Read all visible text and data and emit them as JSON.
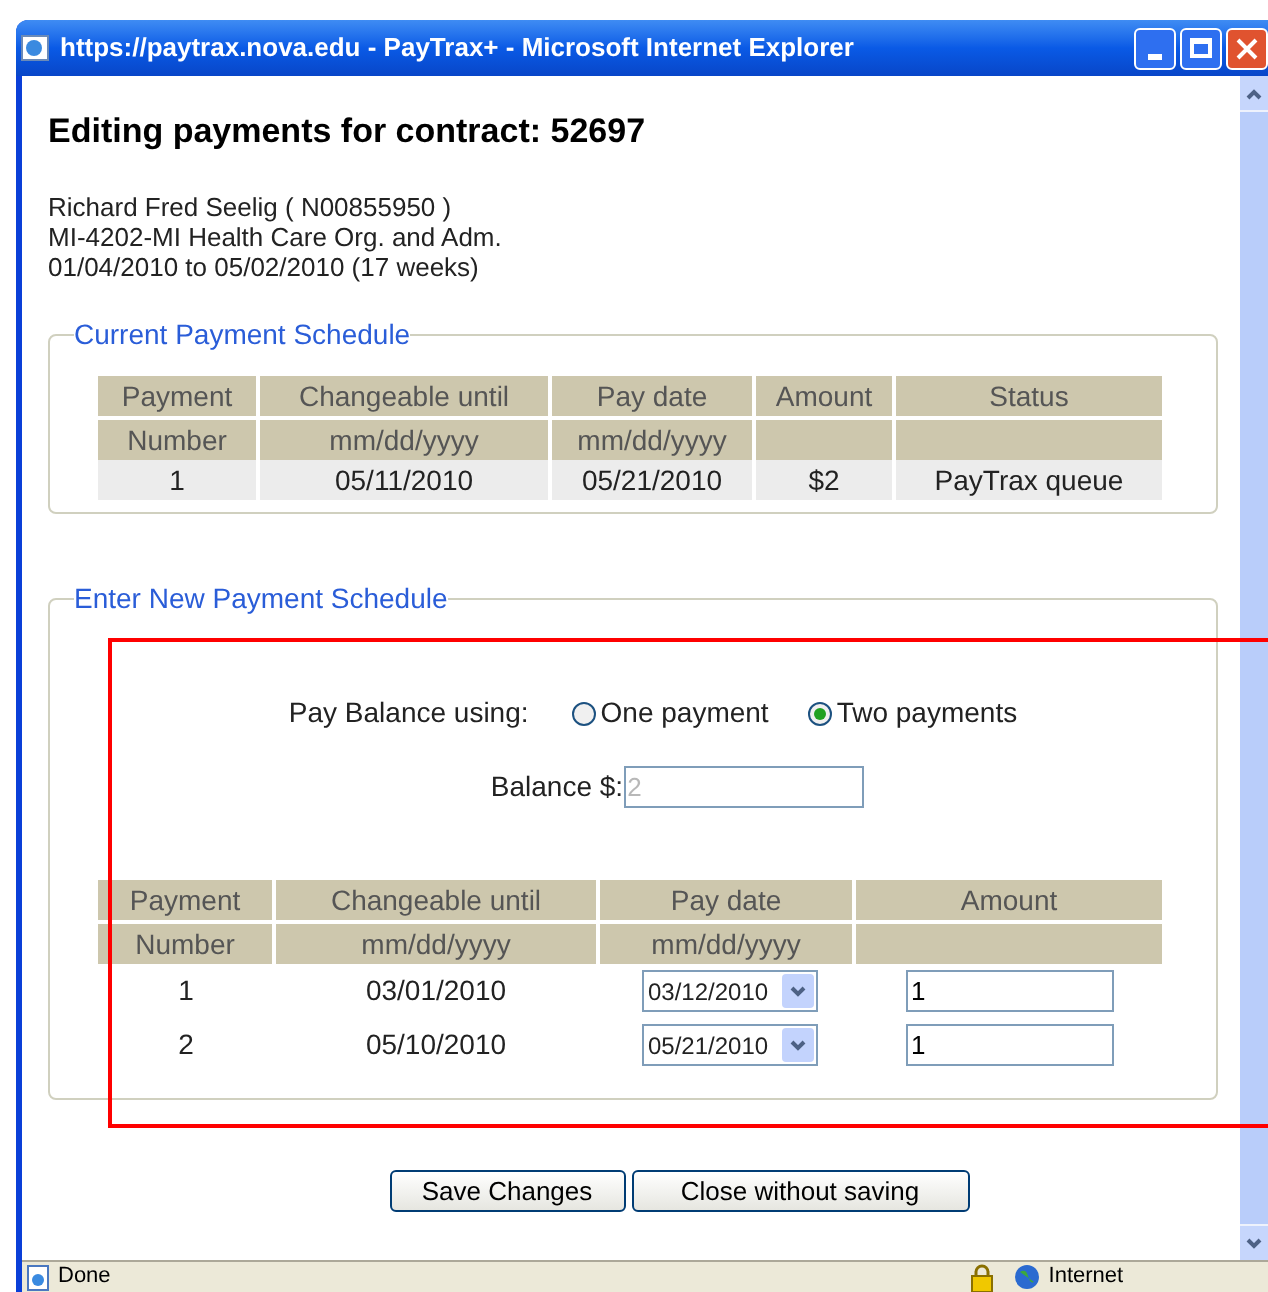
{
  "window": {
    "title": "https://paytrax.nova.edu - PayTrax+ - Microsoft Internet Explorer"
  },
  "heading": "Editing payments for contract: 52697",
  "info_lines": [
    "Richard Fred Seelig ( N00855950 )",
    "MI-4202-MI Health Care Org. and Adm.",
    "01/04/2010  to 05/02/2010 (17 weeks)"
  ],
  "current_schedule": {
    "legend": "Current Payment Schedule",
    "columns": [
      {
        "line1": "Payment",
        "line2": "Number"
      },
      {
        "line1": "Changeable until",
        "line2": "mm/dd/yyyy"
      },
      {
        "line1": "Pay date",
        "line2": "mm/dd/yyyy"
      },
      {
        "line1": "Amount"
      },
      {
        "line1": "Status"
      }
    ],
    "rows": [
      [
        "1",
        "05/11/2010",
        "05/21/2010",
        "$2",
        "PayTrax queue"
      ]
    ]
  },
  "new_schedule": {
    "legend": "Enter New Payment Schedule",
    "pay_balance_label": "Pay Balance using:",
    "options": [
      {
        "label": "One payment",
        "selected": false
      },
      {
        "label": "Two payments",
        "selected": true
      }
    ],
    "balance": {
      "label": "Balance $:",
      "value": "2",
      "disabled": true
    },
    "columns": [
      {
        "line1": "Payment",
        "line2": "Number"
      },
      {
        "line1": "Changeable until",
        "line2": "mm/dd/yyyy"
      },
      {
        "line1": "Pay date",
        "line2": "mm/dd/yyyy"
      },
      {
        "line1": "Amount"
      }
    ],
    "rows": [
      {
        "number": "1",
        "changeable_until": "03/01/2010",
        "pay_date": "03/12/2010",
        "amount": "1"
      },
      {
        "number": "2",
        "changeable_until": "05/10/2010",
        "pay_date": "05/21/2010",
        "amount": "1"
      }
    ]
  },
  "buttons": [
    "Save Changes",
    "Close without saving"
  ],
  "status_bar": {
    "text": "Done",
    "zone": "Internet"
  }
}
